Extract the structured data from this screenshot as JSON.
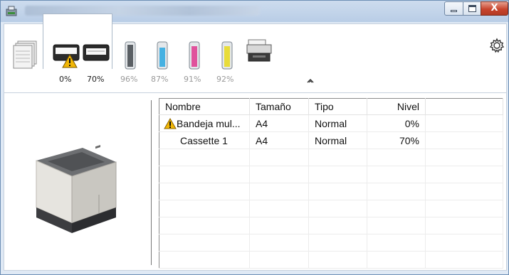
{
  "window": {
    "title": "",
    "controls": {
      "close_label": "X"
    }
  },
  "toolbar": {
    "paper_tab": {
      "icon": "paper-stack-icon"
    },
    "trays": [
      {
        "icon": "tray-warning-icon",
        "level": "0%",
        "warning": true
      },
      {
        "icon": "tray-icon",
        "level": "70%",
        "warning": false
      }
    ],
    "toners": [
      {
        "icon": "toner-black-icon",
        "level": "96%",
        "color": "#4a4a4a"
      },
      {
        "icon": "toner-cyan-icon",
        "level": "87%",
        "color": "#46b1e2"
      },
      {
        "icon": "toner-magenta-icon",
        "level": "91%",
        "color": "#e0529c"
      },
      {
        "icon": "toner-yellow-icon",
        "level": "92%",
        "color": "#e8dc3a"
      }
    ],
    "device_icon": "multifunction-printer-icon",
    "collapse_icon": "chevron-up-icon",
    "settings_icon": "gear-icon"
  },
  "table": {
    "columns": [
      "Nombre",
      "Tamaño",
      "Tipo",
      "Nivel"
    ],
    "rows": [
      {
        "name": "Bandeja mul...",
        "size": "A4",
        "type": "Normal",
        "level": "0%",
        "warning": true
      },
      {
        "name": "Cassette 1",
        "size": "A4",
        "type": "Normal",
        "level": "70%",
        "warning": false
      }
    ],
    "empty_rows": 7
  },
  "colors": {
    "accent": "#dfe9f5",
    "warning": "#f2b705",
    "close": "#c8452e"
  }
}
